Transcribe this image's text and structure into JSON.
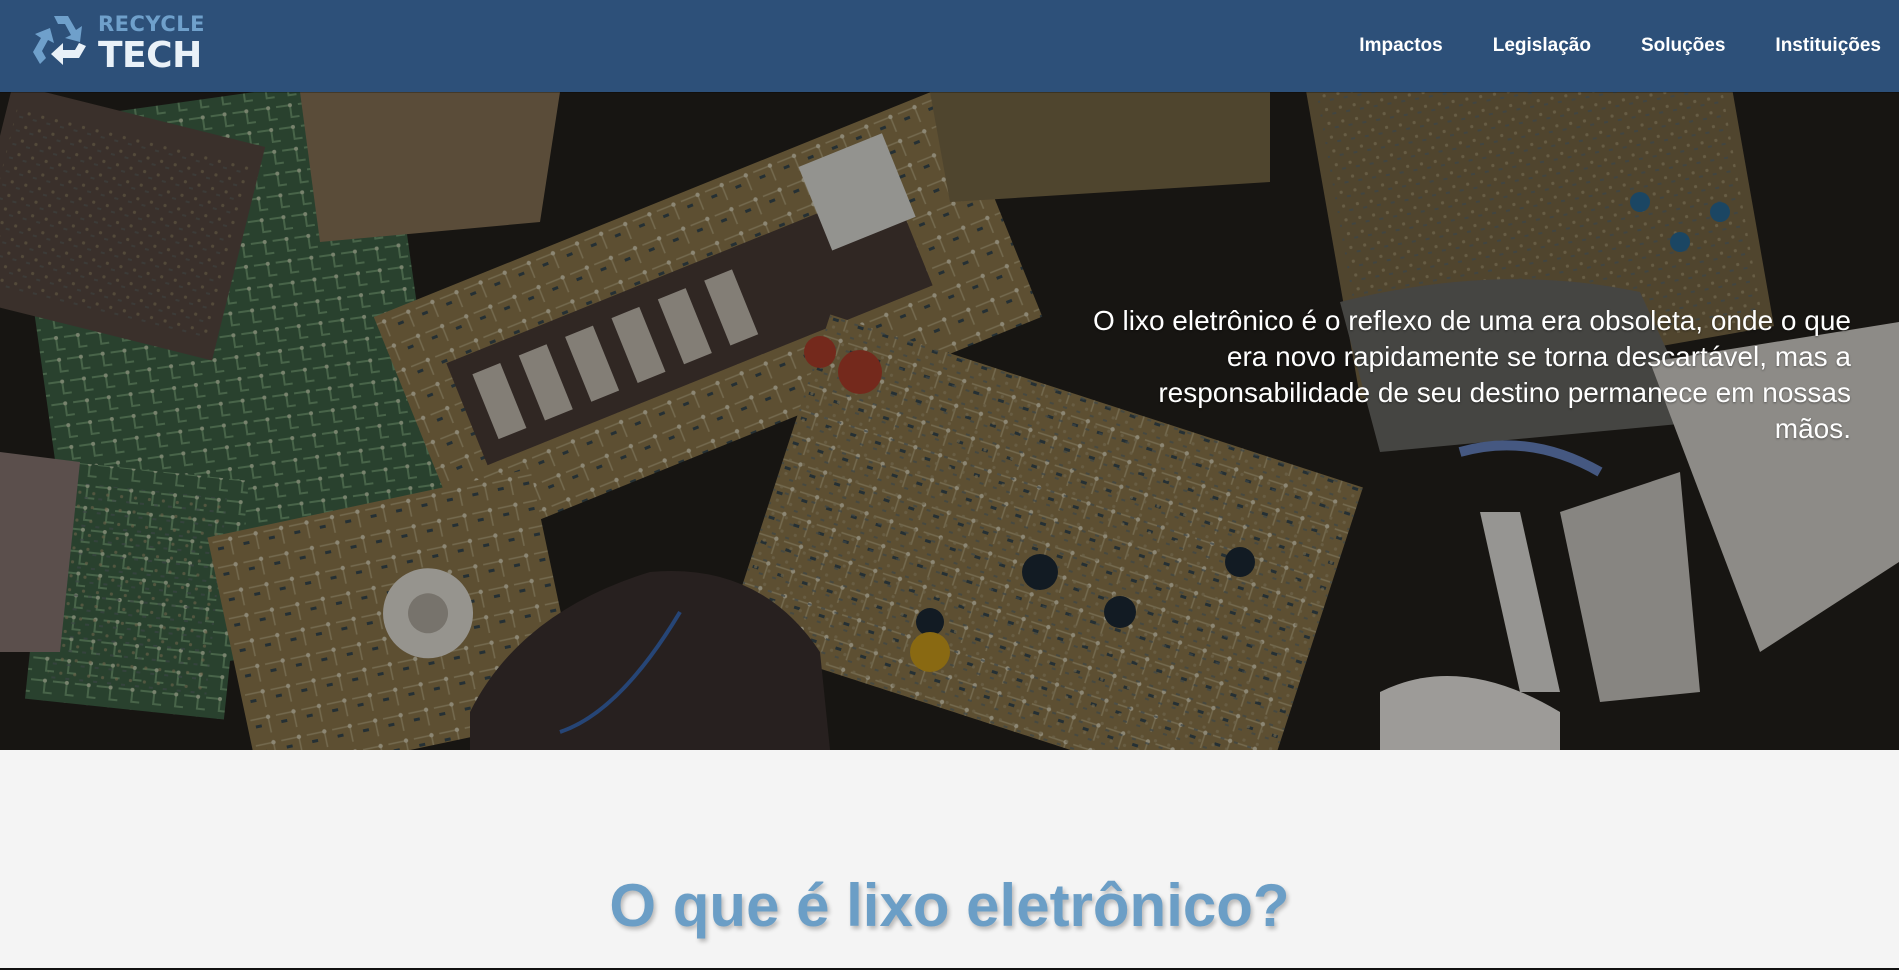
{
  "brand": {
    "line1": "RECYCLE",
    "line2": "TECH",
    "icon": "recycle-icon",
    "accent": "#6fa0cb"
  },
  "nav": {
    "items": [
      {
        "label": "Impactos"
      },
      {
        "label": "Legislação"
      },
      {
        "label": "Soluções"
      },
      {
        "label": "Instituições"
      }
    ]
  },
  "colors": {
    "header_bg": "#2d5079",
    "section_bg": "#f4f4f4",
    "title": "#6b9ec6"
  },
  "hero": {
    "image": "circuit-boards-photo",
    "quote": "O lixo eletrônico é o reflexo de uma era obsoleta, onde o que era novo rapidamente se torna descartável, mas a responsabilidade de seu destino permanece em nossas mãos."
  },
  "section": {
    "title": "O que é lixo eletrônico?"
  }
}
